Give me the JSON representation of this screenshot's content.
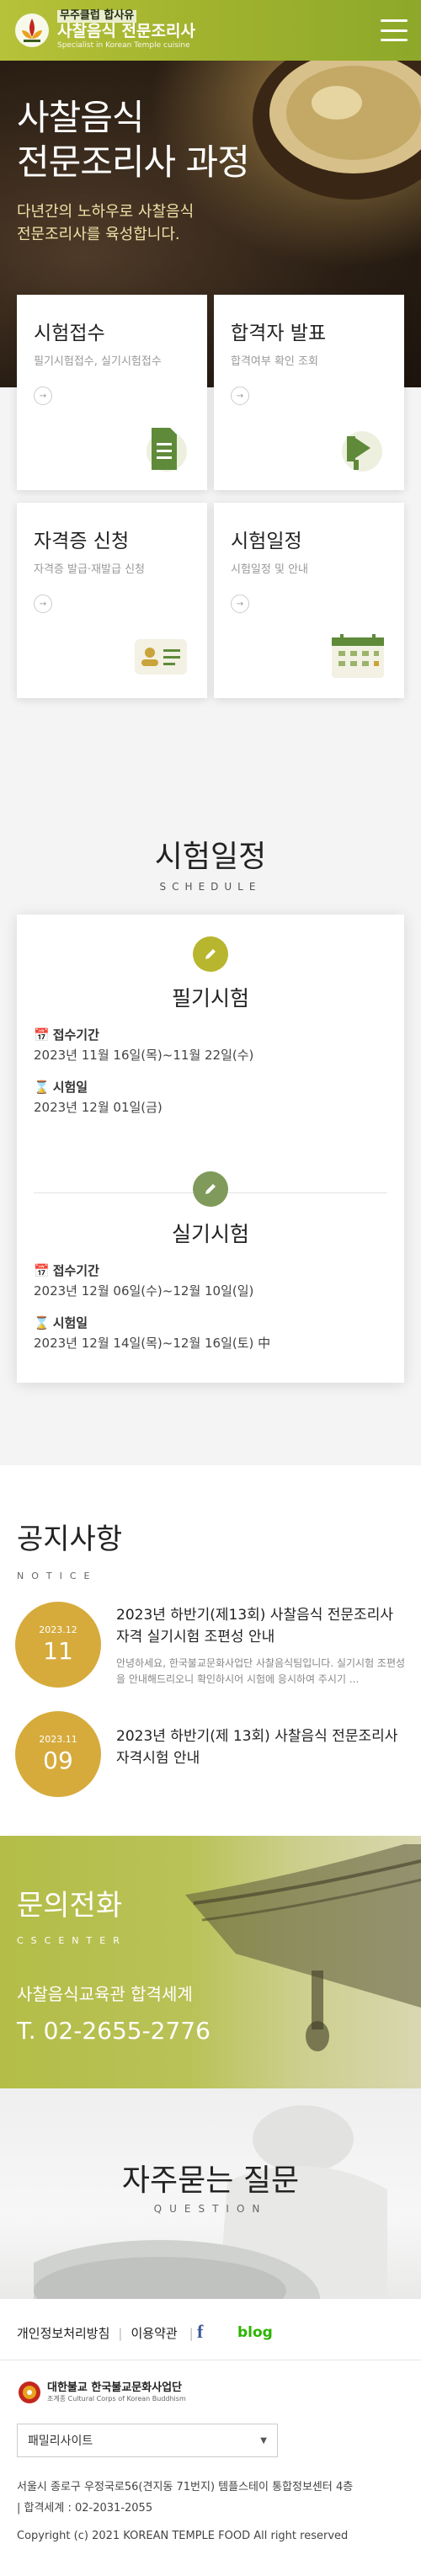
{
  "header": {
    "logo_top": "무주클럽 합사유",
    "logo_main": "사찰음식 전문조리사",
    "logo_sub": "Specialist in Korean Temple cuisine"
  },
  "hero": {
    "title_line1": "사찰음식",
    "title_line2": "전문조리사 과정",
    "desc_line1": "다년간의 노하우로 사찰음식",
    "desc_line2": "전문조리사를 육성합니다."
  },
  "cards": [
    {
      "title": "시험접수",
      "sub": "필기시험접수, 실기시험접수"
    },
    {
      "title": "합격자 발표",
      "sub": "합격여부 확인 조회"
    },
    {
      "title": "자격증 신청",
      "sub": "자격증 발급·재발급 신청"
    },
    {
      "title": "시험일정",
      "sub": "시험일정 및 안내"
    }
  ],
  "schedule": {
    "title": "시험일정",
    "en": "SCHEDULE",
    "exams": [
      {
        "name": "필기시험",
        "apply_label": "접수기간",
        "apply_value": "2023년 11월 16일(목)~11월 22일(수)",
        "date_label": "시험일",
        "date_value": "2023년 12월 01일(금)"
      },
      {
        "name": "실기시험",
        "apply_label": "접수기간",
        "apply_value": "2023년 12월 06일(수)~12월 10일(일)",
        "date_label": "시험일",
        "date_value": "2023년 12월 14일(목)~12월 16일(토) 中"
      }
    ]
  },
  "notice": {
    "title": "공지사항",
    "en": "NOTICE",
    "items": [
      {
        "ym": "2023.12",
        "day": "11",
        "title": "2023년 하반기(제13회) 사찰음식 전문조리사 자격 실기시험 조편성 안내",
        "body": "안녕하세요, 한국불교문화사업단 사찰음식팀입니다. 실기시험 조편성을 안내해드리오니 확인하시어 시험에 응시하여 주시기 ..."
      },
      {
        "ym": "2023.11",
        "day": "09",
        "title": "2023년 하반기(제 13회) 사찰음식 전문조리사 자격시험 안내",
        "body": ""
      }
    ]
  },
  "contact": {
    "title": "문의전화",
    "en": "CSCENTER",
    "org": "사찰음식교육관 합격세계",
    "tel": "T. 02-2655-2776"
  },
  "faq": {
    "title": "자주묻는 질문",
    "en": "QUESTION"
  },
  "footer": {
    "privacy": "개인정보처리방침",
    "terms": "이용약관",
    "facebook": "f",
    "blog": "blog",
    "org_name": "대한불교 한국불교문화사업단",
    "org_name_sub": "조계종 Cultural Corps of Korean Buddhism",
    "family_site": "패밀리사이트",
    "address": "서울시 종로구 우정국로56(견지동 71번지) 템플스테이 통합정보센터 4층",
    "tel": "| 합격세계 : 02-2031-2055",
    "copyright": "Copyright (c) 2021 KOREAN TEMPLE FOOD All right reserved"
  },
  "colors": {
    "brand_green": "#a4b52f",
    "notice_gold": "#d6ab3c",
    "exam1_icon": "#b8b52e",
    "exam2_icon": "#7f9a5a"
  }
}
